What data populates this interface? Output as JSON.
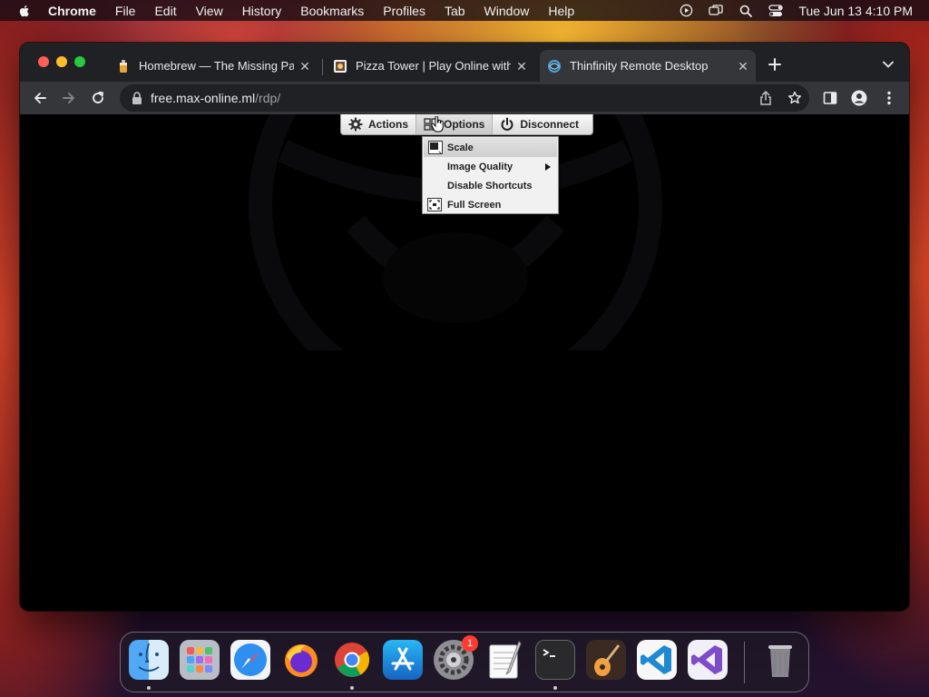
{
  "menubar": {
    "app_name": "Chrome",
    "menus": [
      "File",
      "Edit",
      "View",
      "History",
      "Bookmarks",
      "Profiles",
      "Tab",
      "Window",
      "Help"
    ],
    "clock": "Tue Jun 13  4:10 PM",
    "status_icons": [
      "play-circle-icon",
      "screen-mirroring-icon",
      "spotlight-search-icon",
      "control-center-icon"
    ]
  },
  "browser": {
    "tabs": [
      {
        "title": "Homebrew — The Missing Package Manager for macOS (or Linux)",
        "icon": "homebrew-favicon",
        "active": false
      },
      {
        "title": "Pizza Tower | Play Online without downloading",
        "icon": "pizza-tower-favicon",
        "active": false
      },
      {
        "title": "Thinfinity Remote Desktop",
        "icon": "thinfinity-favicon",
        "active": true
      }
    ],
    "url_host": "free.max-online.ml",
    "url_path": "/rdp/"
  },
  "remote_toolbar": {
    "actions_label": "Actions",
    "options_label": "Options",
    "disconnect_label": "Disconnect"
  },
  "options_menu": {
    "items": [
      {
        "label": "Scale",
        "icon": "scale-icon",
        "highlighted": true
      },
      {
        "label": "Image Quality",
        "submenu": true
      },
      {
        "label": "Disable Shortcuts"
      },
      {
        "label": "Full Screen",
        "icon": "full-screen-icon"
      }
    ]
  },
  "dock": {
    "apps": [
      "Finder",
      "Launchpad",
      "Safari",
      "Firefox",
      "Google Chrome",
      "App Store",
      "System Settings",
      "TextEdit",
      "Terminal",
      "GarageBand",
      "Visual Studio Code",
      "Visual Studio",
      "Trash"
    ],
    "settings_badge": "1"
  },
  "colors": {
    "chrome_tabstrip": "#202124",
    "chrome_toolbar": "#35363a",
    "close_button": "#fe5f57",
    "minimize_button": "#febc2e",
    "maximize_button": "#28c840",
    "badge_red": "#ff3b30"
  }
}
